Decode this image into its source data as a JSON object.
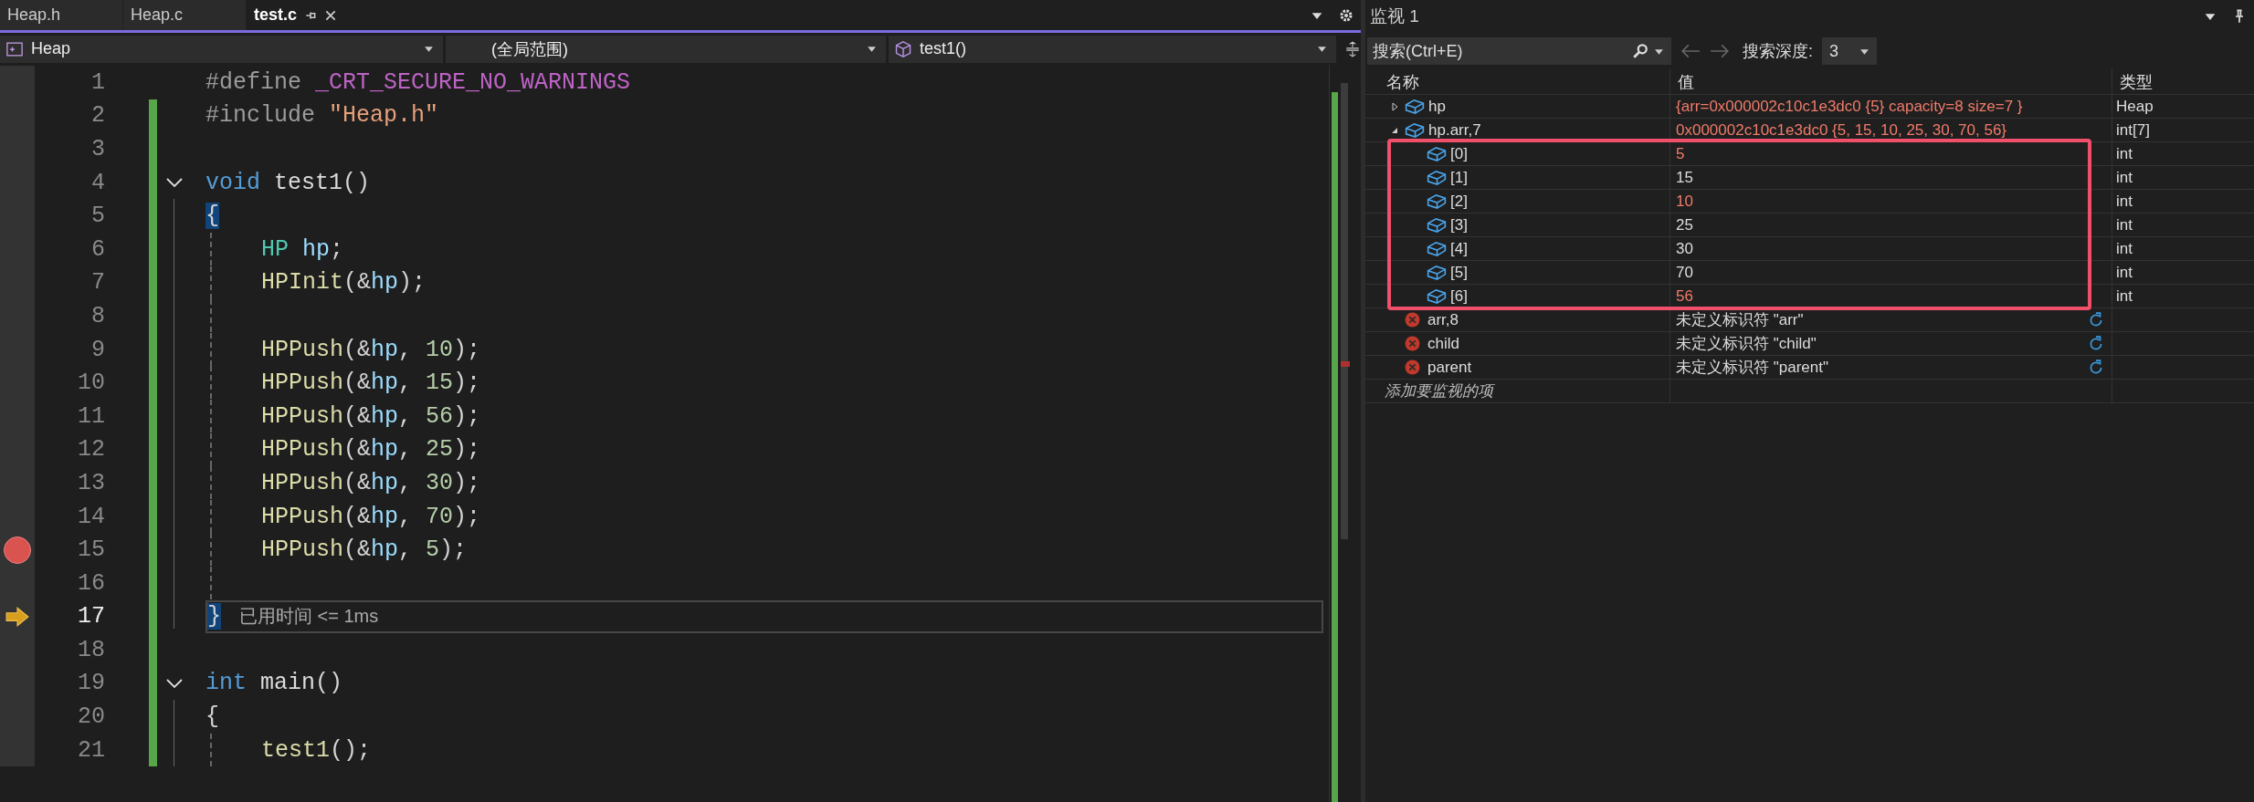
{
  "editor_tabs": [
    {
      "label": "Heap.h",
      "selected": false
    },
    {
      "label": "Heap.c",
      "selected": false
    },
    {
      "label": "test.c",
      "selected": true
    }
  ],
  "navigation_bar": {
    "project": "Heap",
    "scope": "(全局范围)",
    "member": "test1()"
  },
  "code_lines": [
    {
      "number": "1",
      "tokens": [
        {
          "t": "#define ",
          "kind": "preprocessor"
        },
        {
          "t": "_CRT_SECURE_NO_WARNINGS",
          "kind": "macro"
        }
      ],
      "kind": "plain",
      "modified": false,
      "breakpoint": false,
      "current": false
    },
    {
      "number": "2",
      "tokens": [
        {
          "t": "#include ",
          "kind": "preprocessor"
        },
        {
          "t": "\"Heap.h\"",
          "kind": "string"
        }
      ],
      "kind": "plain",
      "modified": true,
      "breakpoint": false,
      "current": false
    },
    {
      "number": "3",
      "kind": "plain",
      "modified": true,
      "breakpoint": false,
      "current": false
    },
    {
      "number": "4",
      "tokens": [
        {
          "t": "void ",
          "kind": "keyword"
        },
        {
          "t": "test1",
          "kind": "plain"
        },
        {
          "t": "()",
          "kind": "punct"
        }
      ],
      "kind": "fold-start",
      "modified": true,
      "breakpoint": false,
      "current": false
    },
    {
      "number": "5",
      "tokens": [
        {
          "t": "{",
          "kind": "brace-match"
        }
      ],
      "kind": "brace",
      "modified": true,
      "breakpoint": false,
      "current": false
    },
    {
      "number": "6",
      "tokens": [
        {
          "t": "HP ",
          "kind": "type"
        },
        {
          "t": "hp",
          "kind": "variable"
        },
        {
          "t": ";",
          "kind": "punct"
        }
      ],
      "kind": "body",
      "modified": true,
      "breakpoint": false,
      "current": false
    },
    {
      "number": "7",
      "tokens": [
        {
          "t": "HPInit",
          "kind": "function"
        },
        {
          "t": "(&",
          "kind": "punct"
        },
        {
          "t": "hp",
          "kind": "variable"
        },
        {
          "t": ");",
          "kind": "punct"
        }
      ],
      "kind": "body",
      "modified": true,
      "breakpoint": false,
      "current": false
    },
    {
      "number": "8",
      "kind": "body",
      "modified": true,
      "breakpoint": false,
      "current": false
    },
    {
      "number": "9",
      "tokens": [
        {
          "t": "HPPush",
          "kind": "function"
        },
        {
          "t": "(&",
          "kind": "punct"
        },
        {
          "t": "hp",
          "kind": "variable"
        },
        {
          "t": ", ",
          "kind": "punct"
        },
        {
          "t": "10",
          "kind": "number"
        },
        {
          "t": ");",
          "kind": "punct"
        }
      ],
      "kind": "body",
      "modified": true,
      "breakpoint": false,
      "current": false
    },
    {
      "number": "10",
      "tokens": [
        {
          "t": "HPPush",
          "kind": "function"
        },
        {
          "t": "(&",
          "kind": "punct"
        },
        {
          "t": "hp",
          "kind": "variable"
        },
        {
          "t": ", ",
          "kind": "punct"
        },
        {
          "t": "15",
          "kind": "number"
        },
        {
          "t": ");",
          "kind": "punct"
        }
      ],
      "kind": "body",
      "modified": true,
      "breakpoint": false,
      "current": false
    },
    {
      "number": "11",
      "tokens": [
        {
          "t": "HPPush",
          "kind": "function"
        },
        {
          "t": "(&",
          "kind": "punct"
        },
        {
          "t": "hp",
          "kind": "variable"
        },
        {
          "t": ", ",
          "kind": "punct"
        },
        {
          "t": "56",
          "kind": "number"
        },
        {
          "t": ");",
          "kind": "punct"
        }
      ],
      "kind": "body",
      "modified": true,
      "breakpoint": false,
      "current": false
    },
    {
      "number": "12",
      "tokens": [
        {
          "t": "HPPush",
          "kind": "function"
        },
        {
          "t": "(&",
          "kind": "punct"
        },
        {
          "t": "hp",
          "kind": "variable"
        },
        {
          "t": ", ",
          "kind": "punct"
        },
        {
          "t": "25",
          "kind": "number"
        },
        {
          "t": ");",
          "kind": "punct"
        }
      ],
      "kind": "body",
      "modified": true,
      "breakpoint": false,
      "current": false
    },
    {
      "number": "13",
      "tokens": [
        {
          "t": "HPPush",
          "kind": "function"
        },
        {
          "t": "(&",
          "kind": "punct"
        },
        {
          "t": "hp",
          "kind": "variable"
        },
        {
          "t": ", ",
          "kind": "punct"
        },
        {
          "t": "30",
          "kind": "number"
        },
        {
          "t": ");",
          "kind": "punct"
        }
      ],
      "kind": "body",
      "modified": true,
      "breakpoint": false,
      "current": false
    },
    {
      "number": "14",
      "tokens": [
        {
          "t": "HPPush",
          "kind": "function"
        },
        {
          "t": "(&",
          "kind": "punct"
        },
        {
          "t": "hp",
          "kind": "variable"
        },
        {
          "t": ", ",
          "kind": "punct"
        },
        {
          "t": "70",
          "kind": "number"
        },
        {
          "t": ");",
          "kind": "punct"
        }
      ],
      "kind": "body",
      "modified": true,
      "breakpoint": false,
      "current": false
    },
    {
      "number": "15",
      "tokens": [
        {
          "t": "HPPush",
          "kind": "function"
        },
        {
          "t": "(&",
          "kind": "punct"
        },
        {
          "t": "hp",
          "kind": "variable"
        },
        {
          "t": ", ",
          "kind": "punct"
        },
        {
          "t": "5",
          "kind": "number"
        },
        {
          "t": ");",
          "kind": "punct"
        }
      ],
      "kind": "body",
      "modified": true,
      "breakpoint": true,
      "current": false
    },
    {
      "number": "16",
      "kind": "body",
      "modified": true,
      "breakpoint": false,
      "current": false
    },
    {
      "number": "17",
      "tokens": [
        {
          "t": "}",
          "kind": "brace-match"
        }
      ],
      "kind": "end",
      "modified": true,
      "breakpoint": false,
      "current": true,
      "hint": "已用时间 <= 1ms"
    },
    {
      "number": "18",
      "kind": "plain",
      "modified": true,
      "breakpoint": false,
      "current": false
    },
    {
      "number": "19",
      "tokens": [
        {
          "t": "int ",
          "kind": "keyword"
        },
        {
          "t": "main",
          "kind": "plain"
        },
        {
          "t": "()",
          "kind": "punct"
        }
      ],
      "kind": "fold-start",
      "modified": true,
      "breakpoint": false,
      "current": false
    },
    {
      "number": "20",
      "tokens": [
        {
          "t": "{",
          "kind": "punct"
        }
      ],
      "kind": "brace",
      "modified": true,
      "breakpoint": false,
      "current": false
    },
    {
      "number": "21",
      "tokens": [
        {
          "t": "test1",
          "kind": "function"
        },
        {
          "t": "();",
          "kind": "punct"
        }
      ],
      "kind": "body",
      "modified": true,
      "breakpoint": false,
      "current": false
    }
  ],
  "watch_panel": {
    "title": "监视 1",
    "search": {
      "placeholder": "搜索(Ctrl+E)"
    },
    "depth_label": "搜索深度:",
    "depth": "3",
    "columns": [
      "名称",
      "值",
      "类型"
    ],
    "rows": [
      {
        "name": "hp",
        "value": "{arr=0x000002c10c1e3dc0 {5} capacity=8 size=7 }",
        "type": "Heap",
        "kind": "object",
        "expanded": false,
        "changed": true
      },
      {
        "name": "hp.arr,7",
        "value": "0x000002c10c1e3dc0 {5, 15, 10, 25, 30, 70, 56}",
        "type": "int[7]",
        "kind": "object",
        "expanded": true,
        "changed": true,
        "children": [
          {
            "name": "[0]",
            "value": "5",
            "type": "int",
            "changed": true
          },
          {
            "name": "[1]",
            "value": "15",
            "type": "int",
            "changed": false
          },
          {
            "name": "[2]",
            "value": "10",
            "type": "int",
            "changed": true
          },
          {
            "name": "[3]",
            "value": "25",
            "type": "int",
            "changed": false
          },
          {
            "name": "[4]",
            "value": "30",
            "type": "int",
            "changed": false
          },
          {
            "name": "[5]",
            "value": "70",
            "type": "int",
            "changed": false
          },
          {
            "name": "[6]",
            "value": "56",
            "type": "int",
            "changed": true
          }
        ]
      },
      {
        "name": "arr,8",
        "value": "未定义标识符 \"arr\"",
        "kind": "error",
        "changed": false
      },
      {
        "name": "child",
        "value": "未定义标识符 \"child\"",
        "kind": "error",
        "changed": false
      },
      {
        "name": "parent",
        "value": "未定义标识符 \"parent\"",
        "kind": "error",
        "changed": false
      }
    ],
    "add_item_placeholder": "添加要监视的项"
  }
}
